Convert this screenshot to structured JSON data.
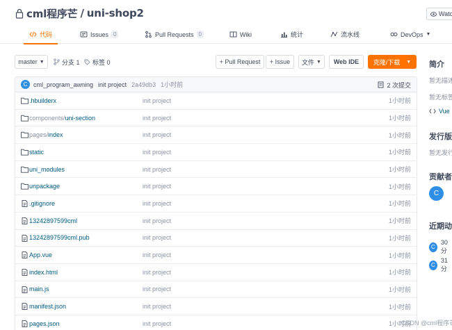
{
  "repo": {
    "owner": "cml程序芒",
    "separator": " / ",
    "name": "uni-shop2",
    "watch_label": "Watc"
  },
  "tabs": [
    {
      "label": "代码",
      "icon": "code-icon"
    },
    {
      "label": "Issues",
      "badge": "0",
      "icon": "issues-icon"
    },
    {
      "label": "Pull Requests",
      "badge": "0",
      "icon": "pull-request-icon"
    },
    {
      "label": "Wiki",
      "icon": "wiki-icon"
    },
    {
      "label": "统计",
      "icon": "stats-icon"
    },
    {
      "label": "流水线",
      "icon": "pipeline-icon"
    },
    {
      "label": "DevOps",
      "icon": "devops-icon"
    }
  ],
  "toolbar": {
    "branch": "master",
    "branches": "分支 1",
    "tags": "标签 0",
    "pull_request": "+ Pull Request",
    "issue": "+ Issue",
    "files": "文件",
    "web_ide": "Web IDE",
    "clone": "克隆/下载"
  },
  "commit": {
    "avatar": "C",
    "author": "cml_program_awning",
    "message": "init project",
    "sha": "2a49db3",
    "time": "1小时前",
    "count": "2 次提交"
  },
  "files": [
    {
      "type": "folder",
      "name": ".hbuilderx",
      "msg": "init project",
      "time": "1小时前"
    },
    {
      "type": "folder",
      "name_dim": "components/",
      "name": "uni-section",
      "msg": "init project",
      "time": "1小时前"
    },
    {
      "type": "folder",
      "name_dim": "pages/",
      "name": "index",
      "msg": "init project",
      "time": "1小时前"
    },
    {
      "type": "folder",
      "name": "static",
      "msg": "init project",
      "time": "1小时前"
    },
    {
      "type": "folder",
      "name": "uni_modules",
      "msg": "init project",
      "time": "1小时前"
    },
    {
      "type": "folder",
      "name": "unpackage",
      "msg": "init project",
      "time": "1小时前"
    },
    {
      "type": "file",
      "name": ".gitignore",
      "msg": "init project",
      "time": "1小时前"
    },
    {
      "type": "file",
      "name": "13242897599cml",
      "msg": "init project",
      "time": "1小时前"
    },
    {
      "type": "file",
      "name": "13242897599cml.pub",
      "msg": "init project",
      "time": "1小时前"
    },
    {
      "type": "file",
      "name": "App.vue",
      "msg": "init project",
      "time": "1小时前"
    },
    {
      "type": "file",
      "name": "index.html",
      "msg": "init project",
      "time": "1小时前"
    },
    {
      "type": "file",
      "name": "main.js",
      "msg": "init project",
      "time": "1小时前"
    },
    {
      "type": "file",
      "name": "manifest.json",
      "msg": "init project",
      "time": "1小时前"
    },
    {
      "type": "file",
      "name": "pages.json",
      "msg": "init project",
      "time": "1小时前"
    }
  ],
  "sidebar": {
    "intro_title": "简介",
    "intro_text": "暂无描述",
    "tags_text": "暂无标签",
    "language": "Vue",
    "release_title": "发行版",
    "release_text": "暂无发行",
    "contrib_title": "贡献者",
    "contrib_avatar": "C",
    "activity_title": "近期动",
    "activity": [
      {
        "avatar": "C",
        "text": "30分"
      },
      {
        "avatar": "C",
        "text": "31分"
      }
    ]
  },
  "watermark": "CSDN @cml程序芒",
  "colors": {
    "accent": "#fe7300",
    "link": "#005980",
    "avatar": "#2f8fe6"
  }
}
